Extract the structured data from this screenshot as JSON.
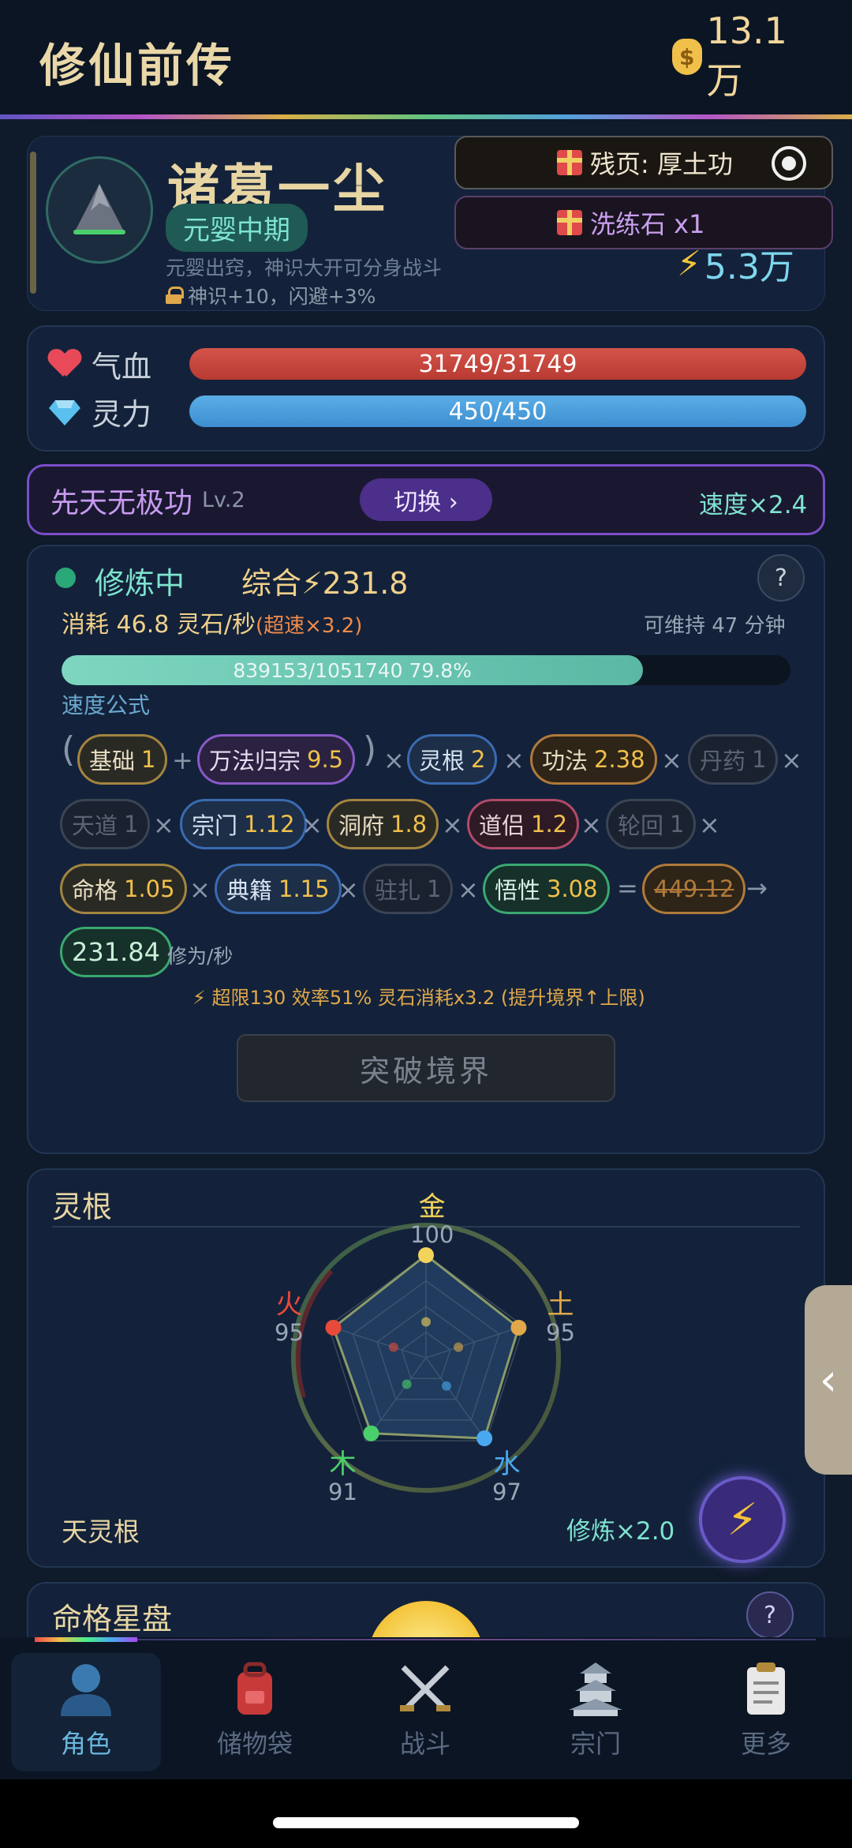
{
  "header": {
    "title": "修仙前传",
    "currency": "13.1万"
  },
  "character": {
    "name": "诸葛一尘",
    "realm": "元婴中期",
    "realm_desc": "元婴出窍，神识大开可分身战斗",
    "buff": "神识+10，闪避+3%",
    "power": "5.3万"
  },
  "notices": {
    "first": "残页: 厚土功",
    "second": "洗练石 x1"
  },
  "stats": {
    "hp_label": "气血",
    "hp_value": "31749/31749",
    "mp_label": "灵力",
    "mp_value": "450/450"
  },
  "skill": {
    "name": "先天无极功",
    "level": "Lv.2",
    "switch_label": "切换 ›",
    "speed": "速度×2.4"
  },
  "cultivation": {
    "status": "修炼中",
    "total": "综合⚡231.8",
    "consume": "消耗 46.8 灵石/秒",
    "consume_extra": "(超速×3.2)",
    "sustain": "可维持 47 分钟",
    "progress_text": "839153/1051740  79.8%",
    "progress": 0.798,
    "formula_title": "速度公式",
    "help": "?"
  },
  "formula": {
    "open_paren": "(",
    "close_paren": ")",
    "plus": "+",
    "times": "×",
    "equals": "=",
    "arrow": "→",
    "base": {
      "label": "基础",
      "value": "1"
    },
    "wanfa": {
      "label": "万法归宗",
      "value": "9.5"
    },
    "linggen": {
      "label": "灵根",
      "value": "2"
    },
    "gongfa": {
      "label": "功法",
      "value": "2.38"
    },
    "danyao": {
      "label": "丹药",
      "value": "1"
    },
    "tiandao": {
      "label": "天道",
      "value": "1"
    },
    "zongmen": {
      "label": "宗门",
      "value": "1.12"
    },
    "dongfu": {
      "label": "洞府",
      "value": "1.8"
    },
    "daolv": {
      "label": "道侣",
      "value": "1.2"
    },
    "lunhui": {
      "label": "轮回",
      "value": "1"
    },
    "mingge": {
      "label": "命格",
      "value": "1.05"
    },
    "dianji": {
      "label": "典籍",
      "value": "1.15"
    },
    "zhuzha": {
      "label": "驻扎",
      "value": "1"
    },
    "wuxing": {
      "label": "悟性",
      "value": "3.08"
    },
    "pre_cap": "449.12",
    "result": "231.84",
    "unit": "修为/秒",
    "overlimit": "⚡ 超限130 效率51% 灵石消耗x3.2 (提升境界↑上限)"
  },
  "breakthrough_label": "突破境界",
  "spirit_root": {
    "title": "灵根",
    "type": "天灵根",
    "multiplier": "修炼×2.0",
    "elements": [
      {
        "name": "金",
        "value": "100",
        "color": "#f3d45a"
      },
      {
        "name": "土",
        "value": "95",
        "color": "#e0a84a"
      },
      {
        "name": "水",
        "value": "97",
        "color": "#4aa8f0"
      },
      {
        "name": "木",
        "value": "91",
        "color": "#4ad06a"
      },
      {
        "name": "火",
        "value": "95",
        "color": "#e84a3a"
      }
    ]
  },
  "star_panel": {
    "title": "命格星盘",
    "help": "?"
  },
  "nav": [
    {
      "label": "角色",
      "icon": "person-icon",
      "active": true
    },
    {
      "label": "储物袋",
      "icon": "backpack-icon",
      "active": false
    },
    {
      "label": "战斗",
      "icon": "crossed-swords-icon",
      "active": false
    },
    {
      "label": "宗门",
      "icon": "pagoda-icon",
      "active": false
    },
    {
      "label": "更多",
      "icon": "clipboard-icon",
      "active": false
    }
  ]
}
